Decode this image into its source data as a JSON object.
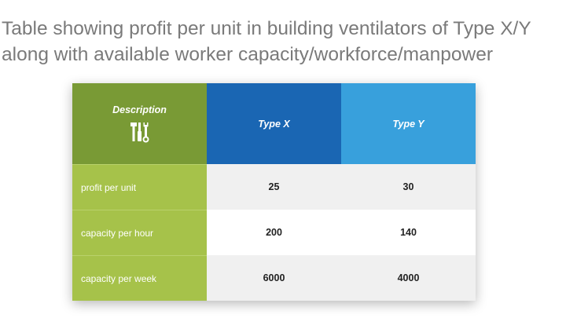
{
  "title": "Table showing profit per unit in building ventilators of Type X/Y along with available worker capacity/workforce/manpower",
  "table": {
    "headers": [
      "Description",
      "Type X",
      "Type Y"
    ],
    "header_icon": "tools-icon",
    "rows": [
      {
        "label": "profit per unit",
        "type_x": "25",
        "type_y": "30"
      },
      {
        "label": "capacity per hour",
        "type_x": "200",
        "type_y": "140"
      },
      {
        "label": "capacity per week",
        "type_x": "6000",
        "type_y": "4000"
      }
    ]
  },
  "colors": {
    "description_header": "#799a35",
    "type_x_header": "#1a66b3",
    "type_y_header": "#38a0dc",
    "label_column": "#a6c24a",
    "title_text": "#7a7a7a"
  }
}
